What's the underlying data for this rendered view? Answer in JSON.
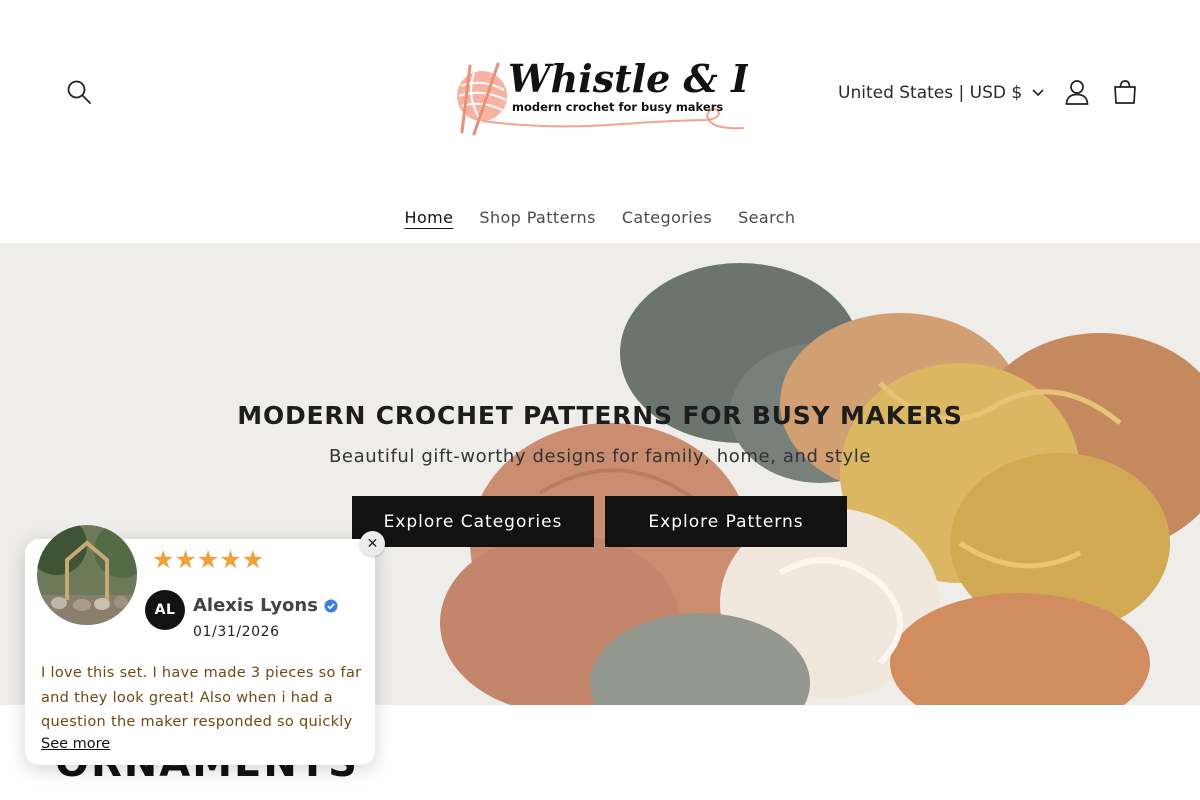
{
  "header": {
    "logo_title": "Whistle & Ivy",
    "logo_tagline": "modern crochet for busy makers",
    "country_label": "United States | USD $",
    "brand_color": "#f3a28f"
  },
  "nav": {
    "items": [
      {
        "label": "Home"
      },
      {
        "label": "Shop Patterns"
      },
      {
        "label": "Categories"
      },
      {
        "label": "Search"
      }
    ]
  },
  "hero": {
    "title": "MODERN CROCHET PATTERNS FOR BUSY MAKERS",
    "subtitle": "Beautiful gift-worthy designs for family, home, and style",
    "button1": "Explore Categories",
    "button2": "Explore Patterns"
  },
  "section": {
    "title": "ORNAMENTS"
  },
  "review": {
    "stars": "★★★★★",
    "rating": 5,
    "initials": "AL",
    "name": "Alexis Lyons",
    "date": "01/31/2026",
    "text": "I love this set. I have made 3 pieces so far and they look great! Also when i had a question the maker responded so quickly i…",
    "see_more": "See more",
    "close_symbol": "✕",
    "star_color": "#f0a13b"
  }
}
